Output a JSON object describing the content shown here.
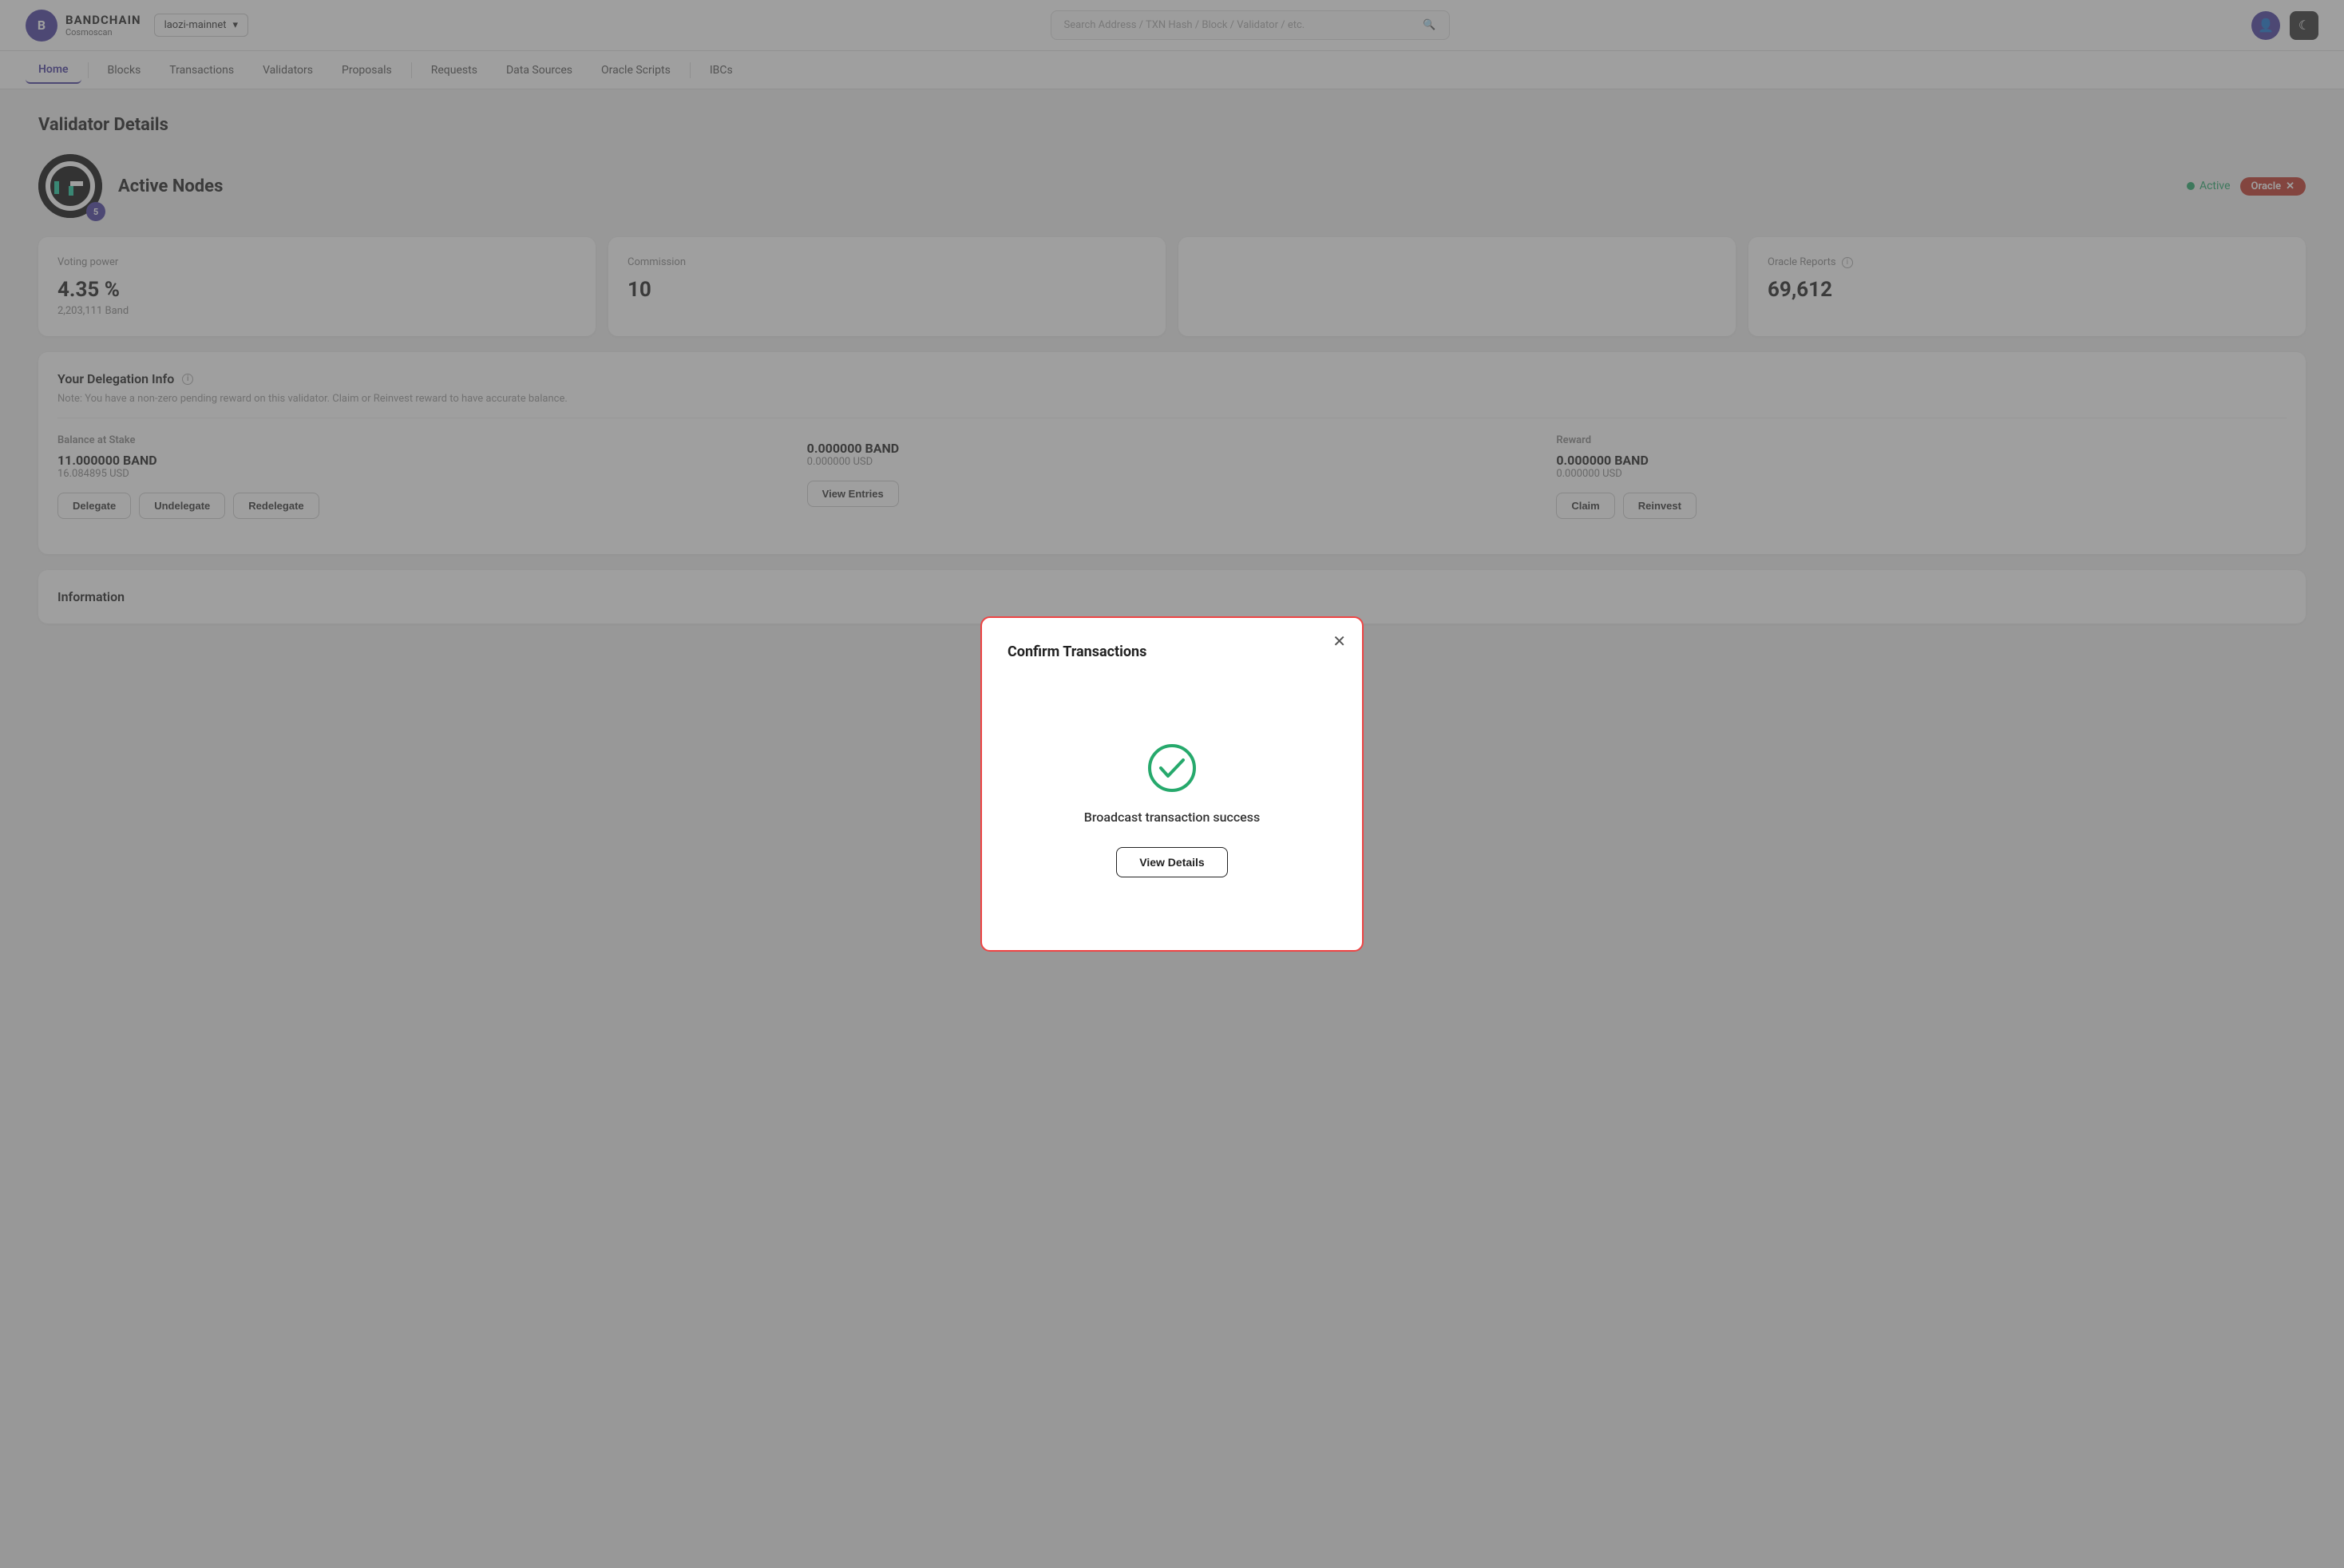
{
  "app": {
    "logo_letter": "B",
    "title": "BANDCHAIN",
    "subtitle": "Cosmoscan"
  },
  "network": {
    "label": "laozi-mainnet",
    "dropdown_icon": "▾"
  },
  "search": {
    "placeholder": "Search Address / TXN Hash / Block / Validator / etc."
  },
  "nav": {
    "items": [
      {
        "label": "Home",
        "active": true
      },
      {
        "label": "Blocks",
        "active": false
      },
      {
        "label": "Transactions",
        "active": false
      },
      {
        "label": "Validators",
        "active": false
      },
      {
        "label": "Proposals",
        "active": false
      },
      {
        "label": "Requests",
        "active": false
      },
      {
        "label": "Data Sources",
        "active": false
      },
      {
        "label": "Oracle Scripts",
        "active": false
      },
      {
        "label": "IBCs",
        "active": false
      }
    ]
  },
  "page": {
    "title": "Validator Details"
  },
  "validator": {
    "name": "Active Nodes",
    "badge_count": "5",
    "status": "Active",
    "oracle_label": "Oracle",
    "logo_bg": "#111"
  },
  "stats": [
    {
      "label": "Voting power",
      "value": "4.35 %",
      "sub": "2,203,111 Band"
    },
    {
      "label": "Commission",
      "value": "10",
      "sub": ""
    },
    {
      "label": "",
      "value": "",
      "sub": ""
    },
    {
      "label": "Oracle Reports",
      "value": "69,612",
      "sub": ""
    }
  ],
  "delegation": {
    "title": "Your Delegation Info",
    "note": "Note: You have a non-zero pending reward on this validator. Claim or Reinvest reward to have accurate balance.",
    "columns": [
      {
        "label": "Balance at Stake",
        "value": "11.000000  BAND",
        "usd": "16.084895  USD"
      },
      {
        "label": "",
        "value": "0.000000  BAND",
        "usd": "0.000000  USD"
      },
      {
        "label": "Reward",
        "value": "0.000000  BAND",
        "usd": "0.000000  USD"
      }
    ],
    "actions_left": [
      "Delegate",
      "Undelegate",
      "Redelegate"
    ],
    "actions_center": [
      "View Entries"
    ],
    "actions_right": [
      "Claim",
      "Reinvest"
    ]
  },
  "information": {
    "title": "Information"
  },
  "modal": {
    "title": "Confirm Transactions",
    "success_message": "Broadcast transaction success",
    "view_details_label": "View Details",
    "close_icon": "✕",
    "success_color": "#26a96c"
  }
}
